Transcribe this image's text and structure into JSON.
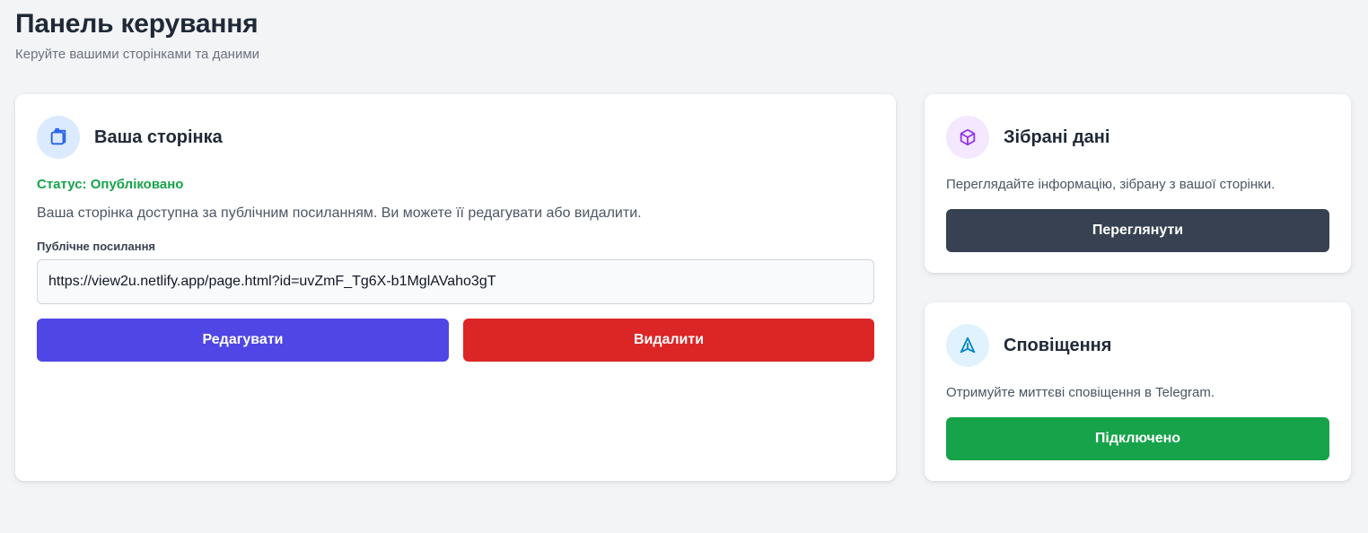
{
  "header": {
    "title": "Панель керування",
    "subtitle": "Керуйте вашими сторінками та даними"
  },
  "page_card": {
    "icon": "document-copy-icon",
    "title": "Ваша сторінка",
    "status": "Статус: Опубліковано",
    "description": "Ваша сторінка доступна за публічним посиланням. Ви можете її редагувати або видалити.",
    "link_label": "Публічне посилання",
    "link_value": "https://view2u.netlify.app/page.html?id=uvZmF_Tg6X-b1MglAVaho3gT",
    "edit_label": "Редагувати",
    "delete_label": "Видалити"
  },
  "data_card": {
    "icon": "cube-icon",
    "title": "Зібрані дані",
    "description": "Переглядайте інформацію, зібрану з вашої сторінки.",
    "view_label": "Переглянути"
  },
  "notifications_card": {
    "icon": "send-icon",
    "title": "Сповіщення",
    "description": "Отримуйте миттєві сповіщення в Telegram.",
    "connected_label": "Підключено"
  },
  "colors": {
    "background": "#f3f4f6",
    "primary": "#4f46e5",
    "danger": "#dc2626",
    "dark": "#374151",
    "success": "#16a34a"
  }
}
